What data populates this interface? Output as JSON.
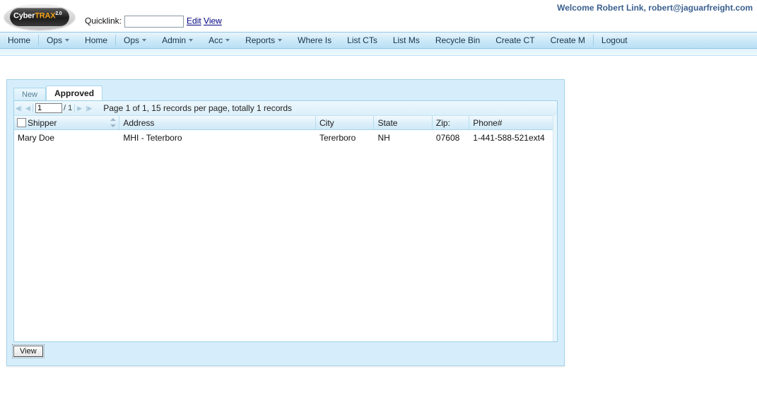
{
  "header": {
    "logo": {
      "part1": "Cyber",
      "part2": "TRAX",
      "version": "2.0"
    },
    "quicklink_label": "Quicklink:",
    "quicklink_value": "",
    "quicklink_placeholder": "",
    "edit_link": "Edit",
    "view_link": "View",
    "welcome": "Welcome Robert Link, robert@jaguarfreight.com",
    "welcome_color": "#3a5f8f"
  },
  "nav": {
    "items": [
      {
        "label": "Home",
        "caret": false,
        "sep_after": true
      },
      {
        "label": "Ops",
        "caret": true,
        "sep_after": false
      },
      {
        "label": "Home",
        "caret": false,
        "sep_after": true
      },
      {
        "label": "Ops",
        "caret": true,
        "sep_after": false
      },
      {
        "label": "Admin",
        "caret": true,
        "sep_after": false
      },
      {
        "label": "Acc",
        "caret": true,
        "sep_after": false
      },
      {
        "label": "Reports",
        "caret": true,
        "sep_after": false
      },
      {
        "label": "Where Is",
        "caret": false,
        "sep_after": false
      },
      {
        "label": "List CTs",
        "caret": false,
        "sep_after": false
      },
      {
        "label": "List Ms",
        "caret": false,
        "sep_after": false
      },
      {
        "label": "Recycle Bin",
        "caret": false,
        "sep_after": false
      },
      {
        "label": "Create CT",
        "caret": false,
        "sep_after": false
      },
      {
        "label": "Create M",
        "caret": false,
        "sep_after": true
      },
      {
        "label": "Logout",
        "caret": false,
        "sep_after": false
      }
    ]
  },
  "panel": {
    "tabs": [
      {
        "label": "New",
        "active": false
      },
      {
        "label": "Approved",
        "active": true
      }
    ],
    "pager": {
      "first_icon": "◀|",
      "prev_icon": "◀",
      "next_icon": "▶",
      "last_icon": "|▶",
      "page_value": "1",
      "total_pages": "/ 1",
      "summary": "Page 1 of 1, 15 records per page, totally 1 records"
    },
    "grid": {
      "columns": [
        {
          "key": "shipper",
          "label": "Shipper",
          "checkbox": true,
          "sortable": true
        },
        {
          "key": "address",
          "label": "Address",
          "checkbox": false,
          "sortable": false
        },
        {
          "key": "city",
          "label": "City",
          "checkbox": false,
          "sortable": false
        },
        {
          "key": "state",
          "label": "State",
          "checkbox": false,
          "sortable": false
        },
        {
          "key": "zip",
          "label": "Zip:",
          "checkbox": false,
          "sortable": false
        },
        {
          "key": "phone",
          "label": "Phone#",
          "checkbox": false,
          "sortable": false
        }
      ],
      "rows": [
        {
          "shipper": "Mary Doe",
          "address": "MHI - Teterboro",
          "city": "Tererboro",
          "state": "NH",
          "zip": "07608",
          "phone": "1-441-588-521ext4"
        }
      ]
    },
    "footer": {
      "view_button": "View"
    }
  }
}
